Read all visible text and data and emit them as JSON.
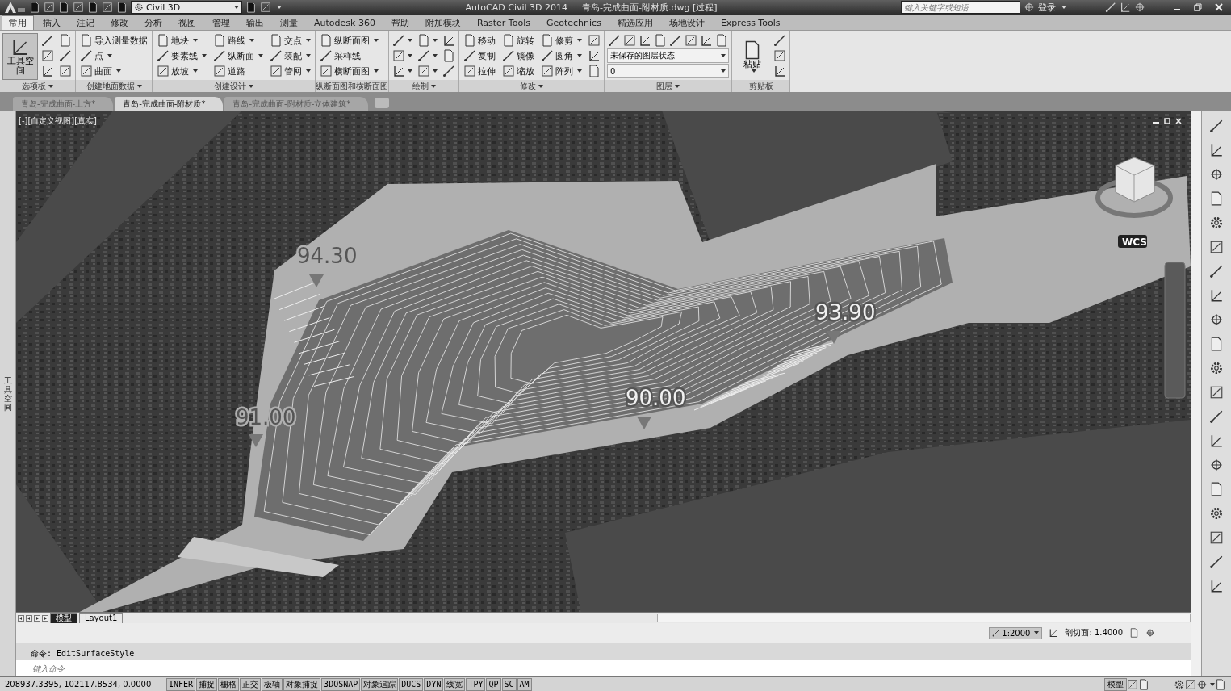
{
  "title_bar": {
    "workspace": "Civil 3D",
    "app_name": "AutoCAD Civil 3D 2014",
    "document": "青岛-完成曲面-附材质.dwg [过程]",
    "search": {
      "placeholder": "键入关键字或短语"
    },
    "sign_in": "登录"
  },
  "ribbon_tabs": [
    {
      "label": "常用",
      "selected": true
    },
    {
      "label": "插入",
      "selected": false
    },
    {
      "label": "注记",
      "selected": false
    },
    {
      "label": "修改",
      "selected": false
    },
    {
      "label": "分析",
      "selected": false
    },
    {
      "label": "视图",
      "selected": false
    },
    {
      "label": "管理",
      "selected": false
    },
    {
      "label": "输出",
      "selected": false
    },
    {
      "label": "测量",
      "selected": false
    },
    {
      "label": "Autodesk 360",
      "selected": false
    },
    {
      "label": "帮助",
      "selected": false
    },
    {
      "label": "附加模块",
      "selected": false
    },
    {
      "label": "Raster Tools",
      "selected": false
    },
    {
      "label": "Geotechnics",
      "selected": false
    },
    {
      "label": "精选应用",
      "selected": false
    },
    {
      "label": "场地设计",
      "selected": false
    },
    {
      "label": "Express Tools",
      "selected": false
    }
  ],
  "ribbon_panels": [
    {
      "title": "选项板",
      "dropdown": true,
      "kind": "columns",
      "items": [
        {
          "kind": "large",
          "label": "工具空间",
          "dropdown": false
        },
        {
          "kind": "icon",
          "dropdown": false
        },
        {
          "kind": "icon",
          "dropdown": false
        },
        {
          "kind": "icon",
          "dropdown": false
        },
        {
          "kind": "icon",
          "dropdown": false
        },
        {
          "kind": "icon",
          "dropdown": false
        },
        {
          "kind": "icon",
          "dropdown": false
        }
      ]
    },
    {
      "title": "创建地面数据",
      "dropdown": true,
      "kind": "columns",
      "items": [
        {
          "kind": "button",
          "label": "导入测量数据",
          "dropdown": false
        },
        {
          "kind": "button",
          "label": "点",
          "dropdown": true
        },
        {
          "kind": "button",
          "label": "曲面",
          "dropdown": true
        }
      ]
    },
    {
      "title": "创建设计",
      "dropdown": true,
      "kind": "columns",
      "items": [
        {
          "kind": "button",
          "label": "地块",
          "dropdown": true
        },
        {
          "kind": "button",
          "label": "要素线",
          "dropdown": true
        },
        {
          "kind": "button",
          "label": "放坡",
          "dropdown": true
        },
        {
          "kind": "button",
          "label": "路线",
          "dropdown": true
        },
        {
          "kind": "button",
          "label": "纵断面",
          "dropdown": true
        },
        {
          "kind": "button",
          "label": "道路",
          "dropdown": false
        },
        {
          "kind": "button",
          "label": "交点",
          "dropdown": true
        },
        {
          "kind": "button",
          "label": "装配",
          "dropdown": true
        },
        {
          "kind": "button",
          "label": "管网",
          "dropdown": true
        }
      ]
    },
    {
      "title": "纵断面图和横断面图",
      "dropdown": false,
      "kind": "columns",
      "items": [
        {
          "kind": "button",
          "label": "纵断面图",
          "dropdown": true
        },
        {
          "kind": "button",
          "label": "采样线",
          "dropdown": false
        },
        {
          "kind": "button",
          "label": "横断面图",
          "dropdown": true
        }
      ]
    },
    {
      "title": "绘制",
      "dropdown": true,
      "kind": "columns",
      "items": [
        {
          "kind": "icon",
          "dropdown": true
        },
        {
          "kind": "icon",
          "dropdown": true
        },
        {
          "kind": "icon",
          "dropdown": true
        },
        {
          "kind": "icon",
          "dropdown": true
        },
        {
          "kind": "icon",
          "dropdown": true
        },
        {
          "kind": "icon",
          "dropdown": true
        },
        {
          "kind": "icon",
          "dropdown": false
        },
        {
          "kind": "icon",
          "dropdown": false
        },
        {
          "kind": "icon",
          "dropdown": false
        }
      ]
    },
    {
      "title": "修改",
      "dropdown": true,
      "kind": "columns",
      "items": [
        {
          "kind": "button",
          "label": "移动",
          "dropdown": false
        },
        {
          "kind": "button",
          "label": "复制",
          "dropdown": false
        },
        {
          "kind": "button",
          "label": "拉伸",
          "dropdown": false
        },
        {
          "kind": "button",
          "label": "旋转",
          "dropdown": false
        },
        {
          "kind": "button",
          "label": "镜像",
          "dropdown": false
        },
        {
          "kind": "button",
          "label": "缩放",
          "dropdown": false
        },
        {
          "kind": "button",
          "label": "修剪",
          "dropdown": true
        },
        {
          "kind": "button",
          "label": "圆角",
          "dropdown": true
        },
        {
          "kind": "button",
          "label": "阵列",
          "dropdown": true
        },
        {
          "kind": "icon",
          "dropdown": false
        },
        {
          "kind": "icon",
          "dropdown": false
        },
        {
          "kind": "icon",
          "dropdown": false
        }
      ]
    },
    {
      "title": "图层",
      "dropdown": true,
      "kind": "rows",
      "items": [
        {
          "kind": "icon",
          "dropdown": false
        },
        {
          "kind": "icon",
          "dropdown": false
        },
        {
          "kind": "icon",
          "dropdown": false
        },
        {
          "kind": "icon",
          "dropdown": false
        },
        {
          "kind": "icon",
          "dropdown": false
        },
        {
          "kind": "icon",
          "dropdown": false
        },
        {
          "kind": "icon",
          "dropdown": false
        },
        {
          "kind": "icon",
          "dropdown": false
        },
        {
          "kind": "combo",
          "label": "未保存的图层状态",
          "dropdown": true
        },
        {
          "kind": "combo",
          "label": "0",
          "dropdown": true
        }
      ]
    },
    {
      "title": "剪贴板",
      "dropdown": false,
      "kind": "columns",
      "items": [
        {
          "kind": "large",
          "label": "粘贴",
          "dropdown": true
        },
        {
          "kind": "icon",
          "dropdown": false
        },
        {
          "kind": "icon",
          "dropdown": false
        },
        {
          "kind": "icon",
          "dropdown": false
        }
      ]
    }
  ],
  "document_tabs": [
    {
      "label": "青岛-完成曲面-土方*",
      "selected": false
    },
    {
      "label": "青岛-完成曲面-附材质*",
      "selected": true
    },
    {
      "label": "青岛-完成曲面-附材质-立体建筑*",
      "selected": false
    }
  ],
  "viewport": {
    "view_label": "[-][自定义视图][真实]",
    "elevation_labels": [
      "94.30",
      "91.00",
      "90.00",
      "93.90"
    ],
    "viewcube_label": "WCS"
  },
  "left_palette_title": "工具空间",
  "layout_tabs": [
    {
      "label": "模型",
      "selected": true
    },
    {
      "label": "Layout1",
      "selected": false
    }
  ],
  "annotation_scale": "1:2000",
  "section_plane": "剖切面: 1.4000",
  "command_line": {
    "history": "命令: EditSurfaceStyle",
    "placeholder": "键入命令"
  },
  "status_bar": {
    "coordinates": "208937.3395, 102117.8534, 0.0000",
    "toggles": [
      "INFER",
      "捕捉",
      "栅格",
      "正交",
      "极轴",
      "对象捕捉",
      "3DOSNAP",
      "对象追踪",
      "DUCS",
      "DYN",
      "线宽",
      "TPY",
      "QP",
      "SC",
      "AM"
    ],
    "space": "模型"
  }
}
